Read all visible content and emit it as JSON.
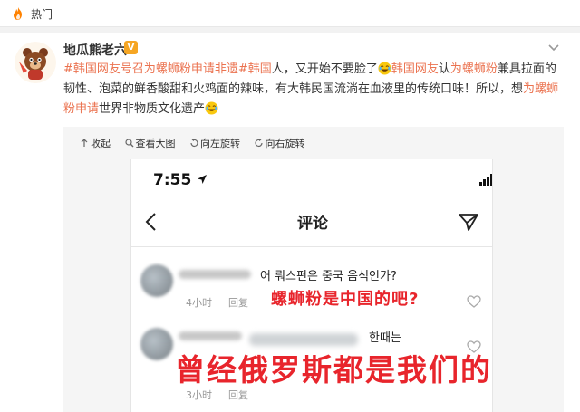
{
  "topbar": {
    "title": "热门",
    "icon": "fire-icon"
  },
  "post": {
    "username": "地瓜熊老六",
    "verified_badge": "V",
    "segments": [
      {
        "text": "#韩国网友号召为螺蛳粉申请非遗#",
        "link": true
      },
      {
        "text": "韩国",
        "link": true
      },
      {
        "text": "人，又开始不要脸了",
        "link": false
      },
      {
        "emoji": "laugh-cry-emoji"
      },
      {
        "text": "韩国网友",
        "link": true
      },
      {
        "text": "认",
        "link": false
      },
      {
        "text": "为螺蛳粉",
        "link": true
      },
      {
        "text": "兼具拉面的韧性、泡菜的鲜香酸甜和火鸡面的辣味，有大韩民国流淌在血液里的传统口味！所以，想",
        "link": false
      },
      {
        "text": "为螺蛳粉申请",
        "link": true
      },
      {
        "text": "世界非物质文化遗产",
        "link": false
      },
      {
        "emoji": "laugh-cry-emoji"
      }
    ],
    "accent_color": "#eb7350"
  },
  "media_tools": [
    {
      "icon": "collapse-icon",
      "label": "收起"
    },
    {
      "icon": "zoom-icon",
      "label": "查看大图"
    },
    {
      "icon": "rotate-left-icon",
      "label": "向左旋转"
    },
    {
      "icon": "rotate-right-icon",
      "label": "向右旋转"
    }
  ],
  "screenshot": {
    "status_time": "7:55",
    "network": "4G",
    "nav_title": "评论",
    "comments": [
      {
        "korean": "어 뤄스펀은 중국 음식인가?",
        "time": "4小时",
        "reply": "回复",
        "caption": "螺蛳粉是中国的吧?"
      },
      {
        "korean": "한때는",
        "time": "3小时",
        "reply": "回复",
        "caption": "曾经俄罗斯都是我们的"
      }
    ],
    "caption_color": "#e8252c"
  }
}
